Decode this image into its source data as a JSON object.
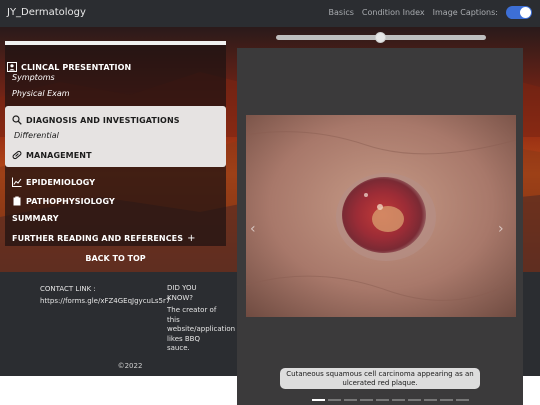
{
  "header": {
    "brand": "JY_Dermatology",
    "nav": [
      "Basics",
      "Condition Index",
      "Image Captions:"
    ],
    "captions_toggle_on": true
  },
  "menu": {
    "clinical_presentation": "CLINCAL PRESENTATION",
    "symptoms": "Symptoms",
    "physical_exam": "Physical Exam",
    "diagnosis": "DIAGNOSIS AND INVESTIGATIONS",
    "differential": "Differential",
    "management": "MANAGEMENT",
    "epidemiology": "EPIDEMIOLOGY",
    "pathophysiology": "PATHOPHYSIOLOGY",
    "summary": "SUMMARY",
    "further_reading": "FURTHER READING AND REFERENCES",
    "plus": "+",
    "back_to_top": "BACK TO TOP"
  },
  "footer": {
    "contact_label": "CONTACT LINK :",
    "contact_link": "https://forms.gle/xFZ4GEqJgycuLs5r7",
    "did_you_know_lines": [
      "DID YOU",
      "KNOW?",
      "The creator of",
      "this",
      "website/application",
      "likes BBQ",
      "sauce."
    ],
    "copyright": "©2022"
  },
  "viewer": {
    "caption_line1": "Cutaneous squamous cell carcinoma appearing as an",
    "caption_line2": "ulcerated red plaque.",
    "prev_icon": "chevron-left-icon",
    "next_icon": "chevron-right-icon",
    "slide_count": 10,
    "active_slide": 1
  }
}
